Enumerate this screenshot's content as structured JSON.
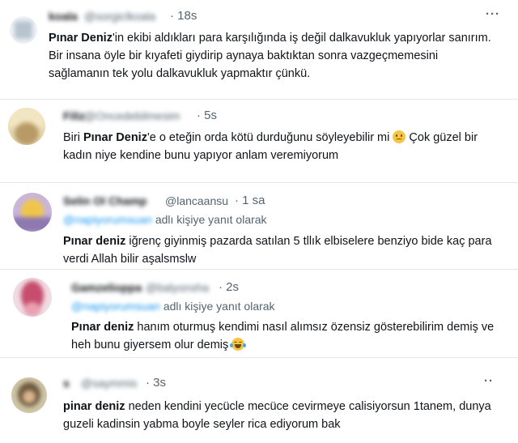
{
  "tweets": [
    {
      "name": "koala",
      "handle": "@sorgiclkoala",
      "time": "· 18s",
      "reply_to": "",
      "reply_suffix": "",
      "body_bold": "Pınar Deniz",
      "body_text": "'in ekibi aldıkları para karşılığında iş değil dalkavukluk yapıyorlar sanırım. Bir insana öyle bir kıyafeti giydirip aynaya baktıktan sonra vazgeçmemesini sağlamanın tek yolu dalkavukluk yapmaktır çünkü.",
      "emoji": ""
    },
    {
      "name": "Filiz",
      "handle": "@Oncedebilmesim",
      "time": "· 5s",
      "reply_to": "",
      "reply_suffix": "",
      "body_prefix": "Biri ",
      "body_bold": "Pınar Deniz",
      "body_text": "'e o eteğin orda kötü durduğunu söyleyebilir mi",
      "emoji": "slightly-frowning-face",
      "body_after_emoji": " Çok güzel bir kadın niye kendine bunu yapıyor anlam veremiyorum"
    },
    {
      "name": "Selin Ol Champ",
      "handle": "@lancaansu",
      "time": "· 1 sa",
      "reply_to": "@napiyorumsuan",
      "reply_suffix": " adlı kişiye yanıt olarak",
      "body_bold": "Pınar deniz",
      "body_text": " iğrenç giyinmiş pazarda satılan 5 tllık elbiselere benziyo bide kaç para verdi Allah bilir aşalsmslw",
      "emoji": ""
    },
    {
      "name": "Gamzelioppa",
      "handle": "@balyonsha",
      "time": "· 2s",
      "reply_to": "@napiyorumsuan",
      "reply_suffix": " adlı kişiye yanıt olarak",
      "body_bold": "Pınar deniz",
      "body_text": " hanım oturmuş kendimi nasıl alımsız özensiz gösterebilirim demiş ve heh bunu giyersem olur demiş",
      "emoji": "face-with-tears-of-joy"
    },
    {
      "name": "s",
      "handle": "@saymmis",
      "time": "· 3s",
      "reply_to": "",
      "reply_suffix": "",
      "body_bold": "pinar deniz",
      "body_text": " neden kendini yecücle mecüce cevirmeye calisiyorsun 1tanem, dunya guzeli kadinsin yabma boyle seyler rica ediyorum bak",
      "emoji": ""
    }
  ],
  "icons": {
    "more": "more-horizontal-icon"
  },
  "colors": {
    "text": "#0f1419",
    "secondary": "#536471",
    "link": "#1d9bf0",
    "separator": "#e6e6e6"
  }
}
